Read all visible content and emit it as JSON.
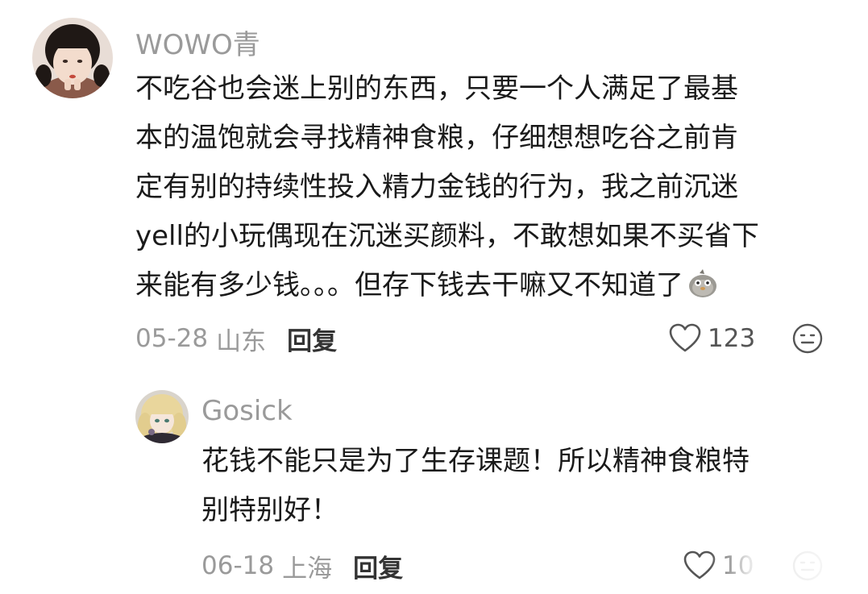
{
  "comment": {
    "username": "WOWO青",
    "lines": [
      "不吃谷也会迷上别的东西，只要一个人满足了最基",
      "本的温饱就会寻找精神食粮，仔细想想吃谷之前肯",
      "定有别的持续性投入精力金钱的行为，我之前沉迷",
      "yell的小玩偶现在沉迷买颜料，不敢想如果不买省下",
      "来能有多少钱。。。但存下钱去干嘛又不知道了"
    ],
    "inline_emoji": "doge-bird-emoji",
    "date": "05-28",
    "location": "山东",
    "reply_label": "回复",
    "like_count": "123"
  },
  "reply": {
    "username": "Gosick",
    "lines": [
      "花钱不能只是为了生存课题！所以精神食粮特",
      "别特别好！"
    ],
    "date": "06-18",
    "location": "上海",
    "reply_label": "回复",
    "like_count": "10"
  },
  "icons": {
    "like": "heart-outline-icon",
    "emoji": "emoji-face-icon"
  },
  "colors": {
    "text": "#1a1a1a",
    "meta": "#9a9a9a",
    "icon": "#555555"
  }
}
